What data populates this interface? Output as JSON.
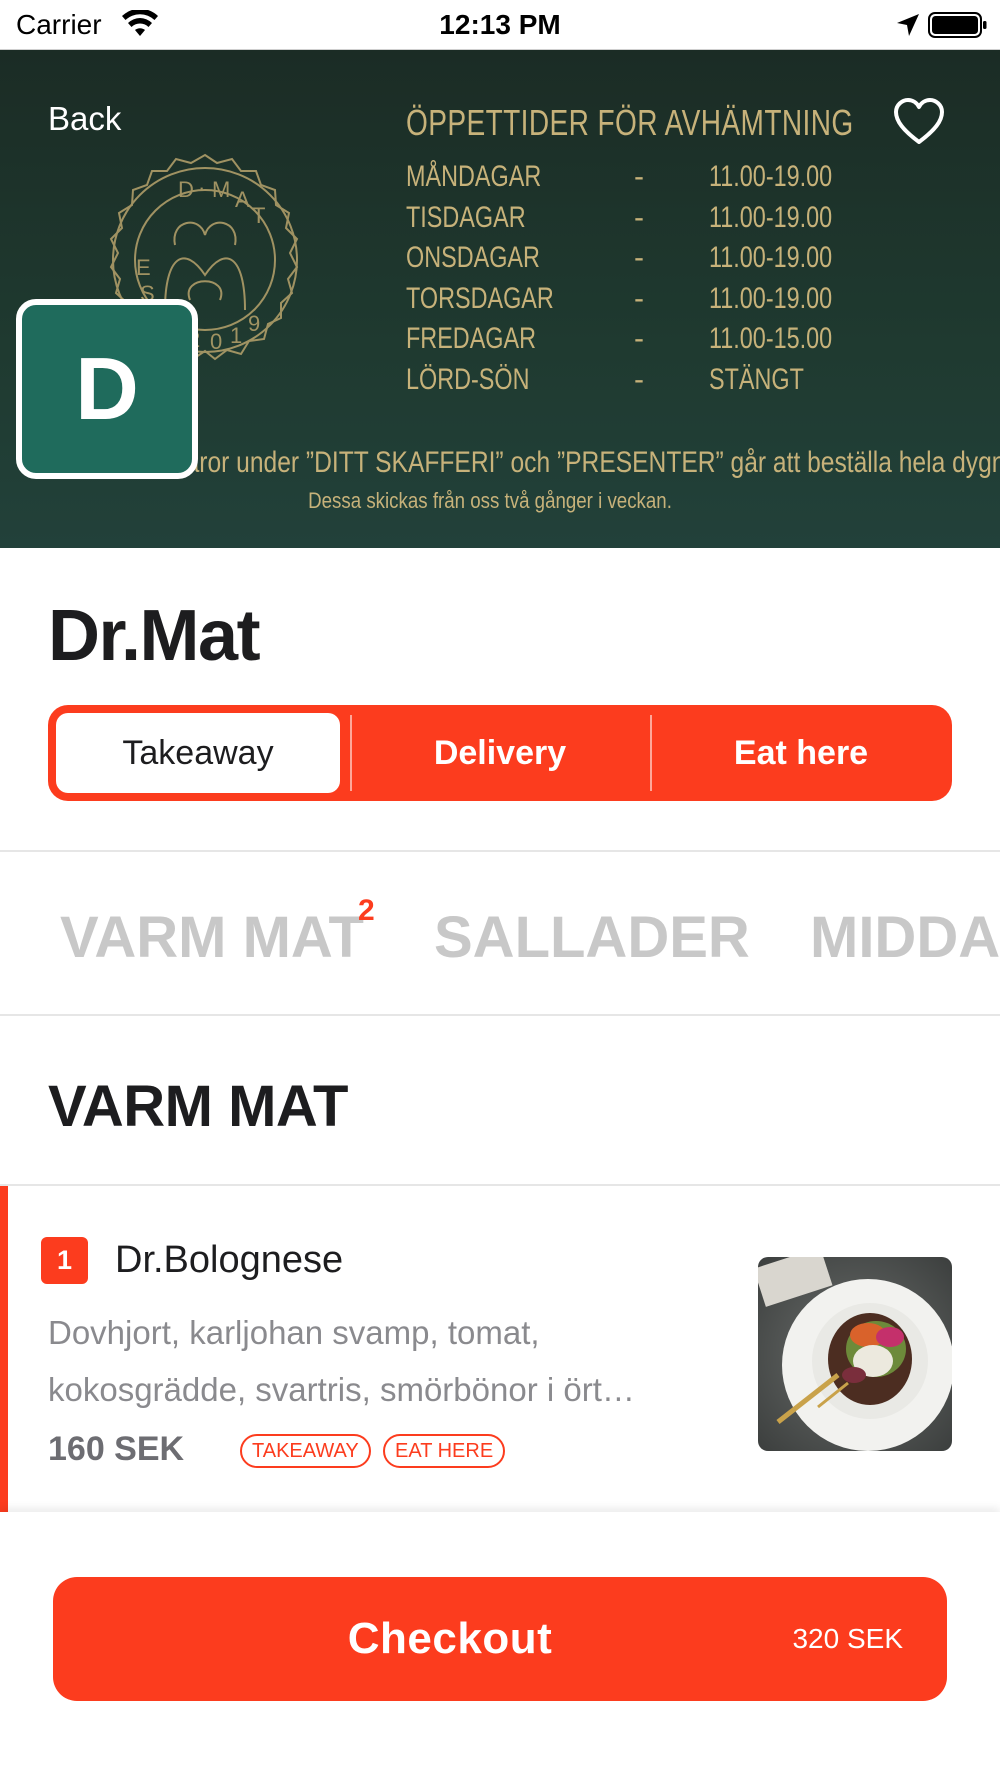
{
  "status_bar": {
    "carrier": "Carrier",
    "time": "12:13 PM"
  },
  "header": {
    "back_label": "Back",
    "seal_logo_text": "DR·MAT · EST 2019",
    "avatar_letter": "D",
    "hours": {
      "title": "ÖPPETTIDER FÖR AVHÄMTNING",
      "rows": [
        {
          "day": "MÅNDAGAR",
          "sep": "-",
          "time": "11.00-19.00"
        },
        {
          "day": "TISDAGAR",
          "sep": "-",
          "time": "11.00-19.00"
        },
        {
          "day": "ONSDAGAR",
          "sep": "-",
          "time": "11.00-19.00"
        },
        {
          "day": "TORSDAGAR",
          "sep": "-",
          "time": "11.00-19.00"
        },
        {
          "day": "FREDAGAR",
          "sep": "-",
          "time": "11.00-15.00"
        },
        {
          "day": "LÖRD-SÖN",
          "sep": "-",
          "time": "STÄNGT"
        }
      ],
      "note": "Varor under ”DITT SKAFFERI” och ”PRESENTER” går att beställa hela dygnet.",
      "subnote": "Dessa skickas från oss två gånger i veckan."
    }
  },
  "restaurant": {
    "name": "Dr.Mat"
  },
  "order_type": {
    "options": [
      "Takeaway",
      "Delivery",
      "Eat here"
    ],
    "selected": "Takeaway"
  },
  "categories": {
    "tabs": [
      "VARM MAT",
      "SALLADER",
      "MIDDAG"
    ],
    "badge": "2"
  },
  "section": {
    "heading": "VARM MAT"
  },
  "menu_items": [
    {
      "quantity": "1",
      "name": "Dr.Bolognese",
      "description": "Dovhjort, karljohan svamp, tomat, kokosgrädde, svartris, smörbönor i ört…",
      "price": "160 SEK",
      "tags": [
        "TAKEAWAY",
        "EAT HERE"
      ]
    }
  ],
  "checkout": {
    "label": "Checkout",
    "total": "320 SEK"
  },
  "colors": {
    "accent": "#fc3c1e",
    "banner": "#1f3a30",
    "gold": "#c7b27a",
    "avatar": "#1f6b5c"
  },
  "icons": [
    "wifi-icon",
    "location-arrow-icon",
    "battery-icon",
    "heart-icon"
  ]
}
